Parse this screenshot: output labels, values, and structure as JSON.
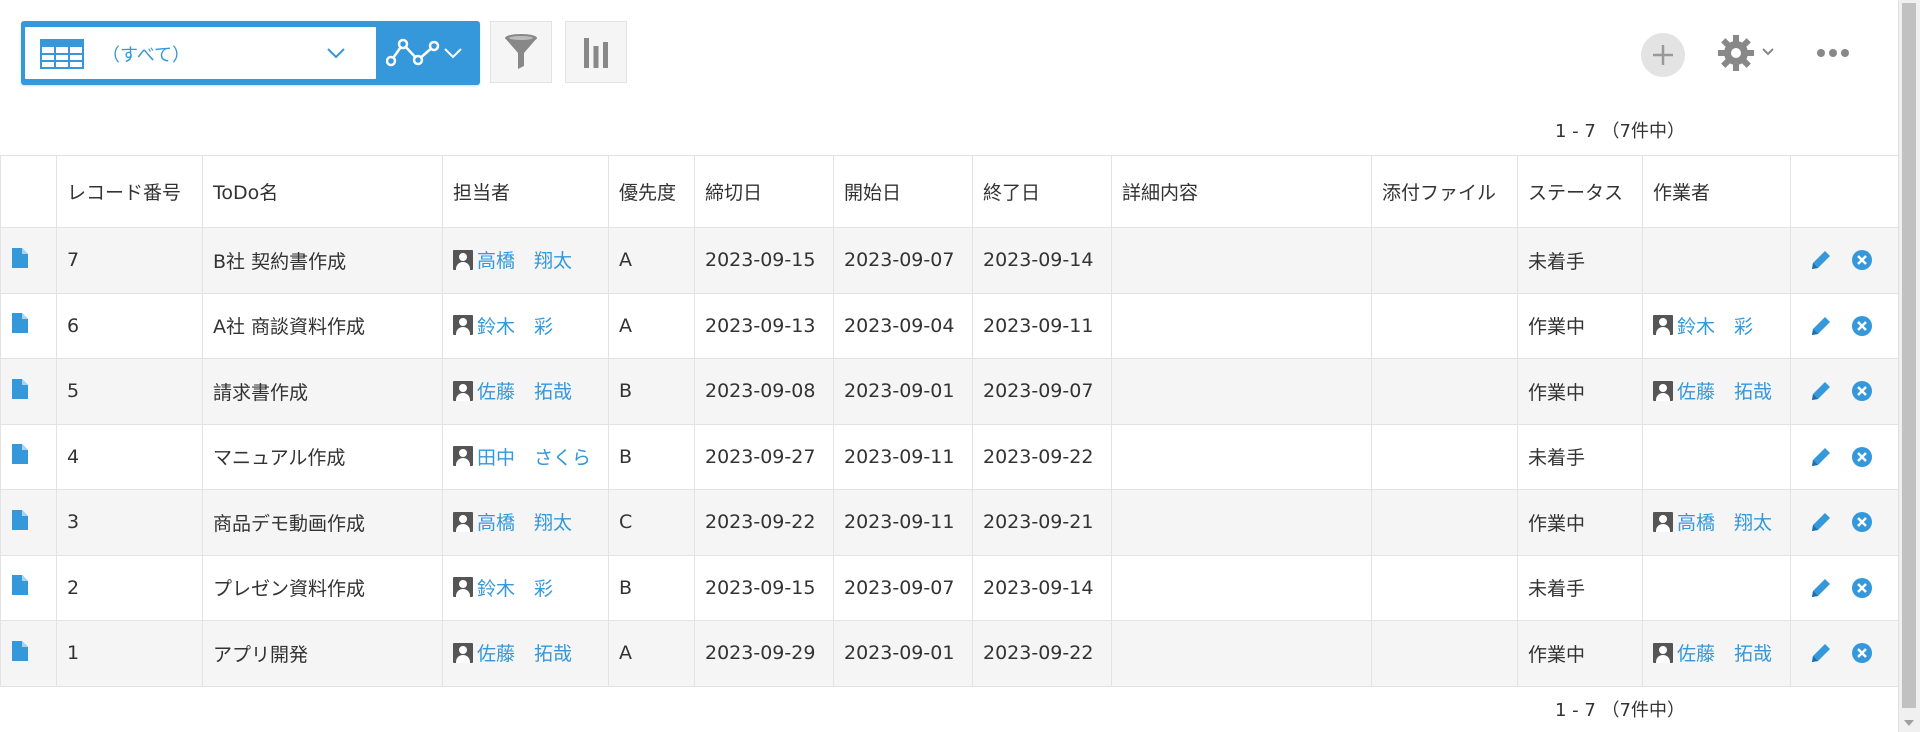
{
  "toolbar": {
    "view_name": "（すべて）",
    "accent_color": "#3498db"
  },
  "pager": {
    "top": "1 - 7 （7件中）",
    "bottom": "1 - 7 （7件中）"
  },
  "table": {
    "columns": [
      "レコード番号",
      "ToDo名",
      "担当者",
      "優先度",
      "締切日",
      "開始日",
      "終了日",
      "詳細内容",
      "添付ファイル",
      "ステータス",
      "作業者"
    ],
    "rows": [
      {
        "id": "7",
        "todo": "B社 契約書作成",
        "assignee": "高橋　翔太",
        "priority": "A",
        "deadline": "2023-09-15",
        "start": "2023-09-07",
        "end": "2023-09-14",
        "detail": "",
        "attachment": "",
        "status": "未着手",
        "worker": ""
      },
      {
        "id": "6",
        "todo": "A社 商談資料作成",
        "assignee": "鈴木　彩",
        "priority": "A",
        "deadline": "2023-09-13",
        "start": "2023-09-04",
        "end": "2023-09-11",
        "detail": "",
        "attachment": "",
        "status": "作業中",
        "worker": "鈴木　彩"
      },
      {
        "id": "5",
        "todo": "請求書作成",
        "assignee": "佐藤　拓哉",
        "priority": "B",
        "deadline": "2023-09-08",
        "start": "2023-09-01",
        "end": "2023-09-07",
        "detail": "",
        "attachment": "",
        "status": "作業中",
        "worker": "佐藤　拓哉"
      },
      {
        "id": "4",
        "todo": "マニュアル作成",
        "assignee": "田中　さくら",
        "priority": "B",
        "deadline": "2023-09-27",
        "start": "2023-09-11",
        "end": "2023-09-22",
        "detail": "",
        "attachment": "",
        "status": "未着手",
        "worker": ""
      },
      {
        "id": "3",
        "todo": "商品デモ動画作成",
        "assignee": "高橋　翔太",
        "priority": "C",
        "deadline": "2023-09-22",
        "start": "2023-09-11",
        "end": "2023-09-21",
        "detail": "",
        "attachment": "",
        "status": "作業中",
        "worker": "高橋　翔太"
      },
      {
        "id": "2",
        "todo": "プレゼン資料作成",
        "assignee": "鈴木　彩",
        "priority": "B",
        "deadline": "2023-09-15",
        "start": "2023-09-07",
        "end": "2023-09-14",
        "detail": "",
        "attachment": "",
        "status": "未着手",
        "worker": ""
      },
      {
        "id": "1",
        "todo": "アプリ開発",
        "assignee": "佐藤　拓哉",
        "priority": "A",
        "deadline": "2023-09-29",
        "start": "2023-09-01",
        "end": "2023-09-22",
        "detail": "",
        "attachment": "",
        "status": "作業中",
        "worker": "佐藤　拓哉"
      }
    ]
  }
}
